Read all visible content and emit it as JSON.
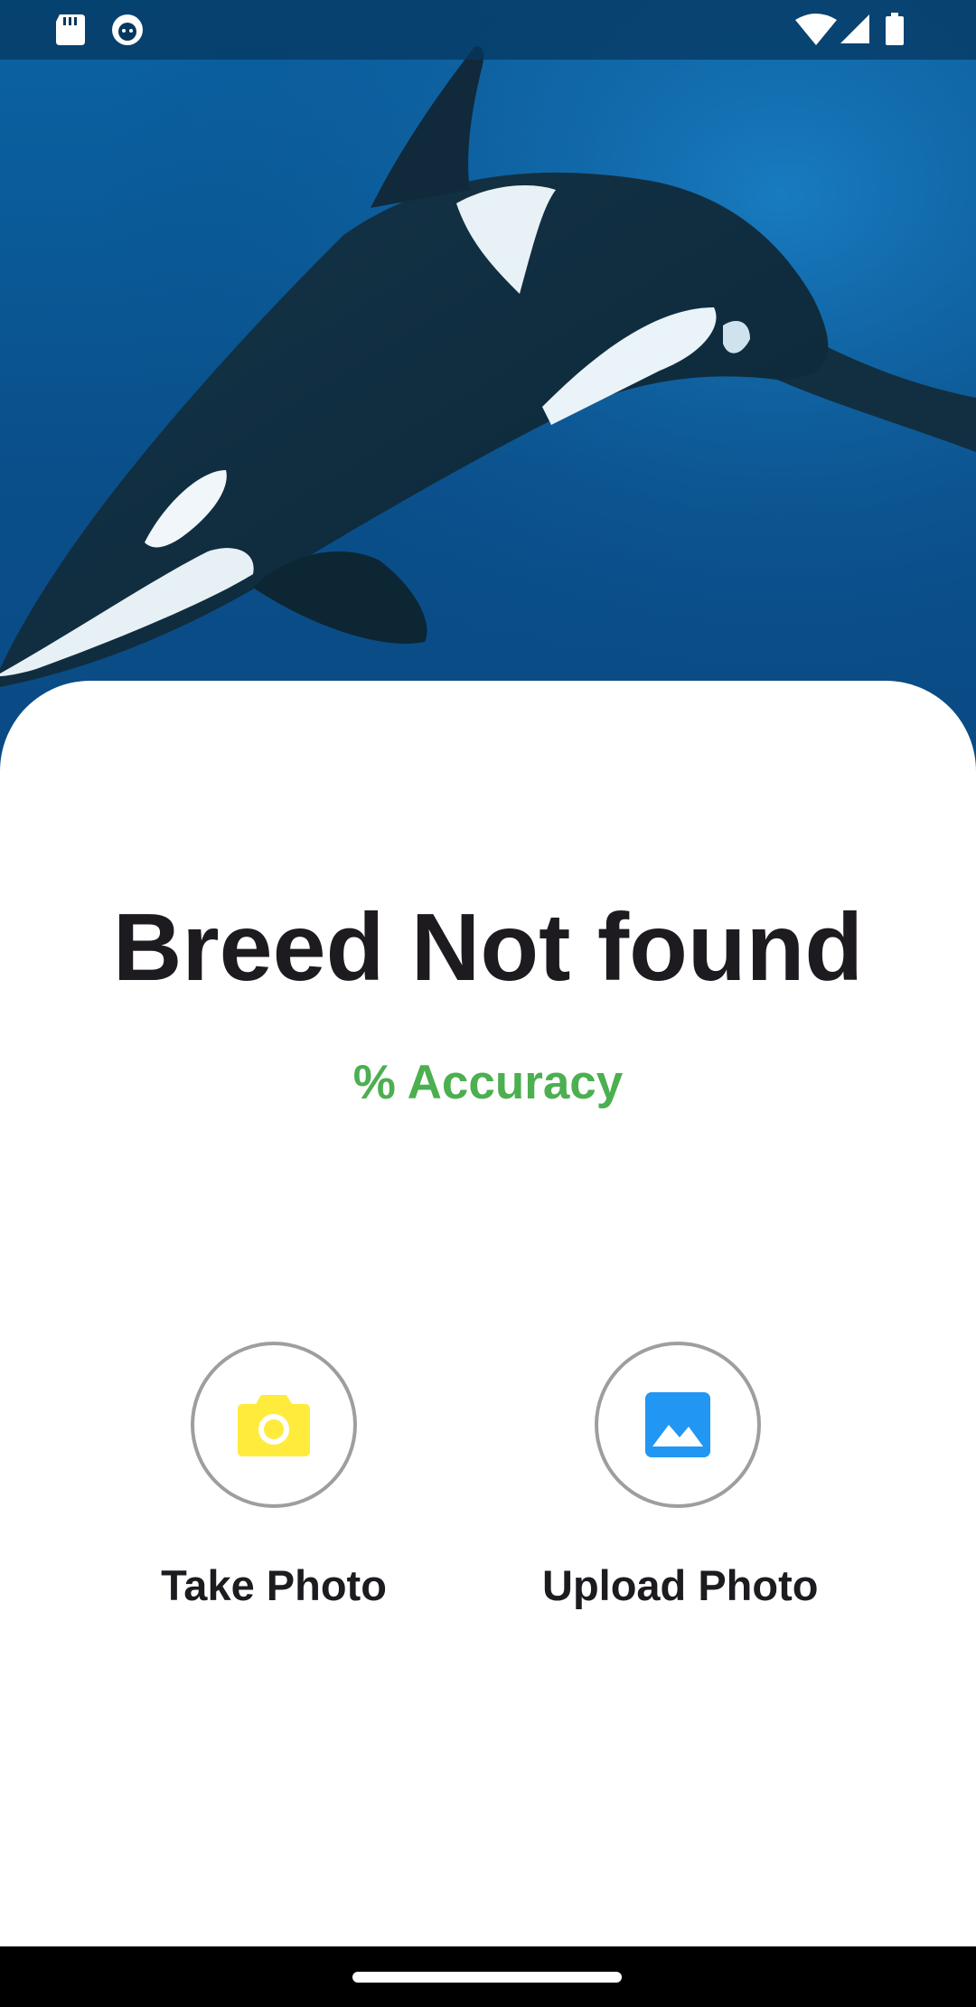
{
  "status_bar": {
    "left_icons": [
      "sd-card-icon",
      "app-notification-icon"
    ],
    "right_icons": [
      "wifi-icon",
      "signal-icon",
      "battery-icon"
    ]
  },
  "hero": {
    "image": "orca-whale-underwater-photo"
  },
  "result": {
    "title": "Breed Not found",
    "accuracy": "% Accuracy"
  },
  "actions": {
    "take_photo_label": "Take Photo",
    "upload_photo_label": "Upload Photo"
  },
  "colors": {
    "accuracy": "#4caf50",
    "camera_icon": "#ffeb3b",
    "gallery_icon": "#2196f3",
    "circle_border": "#9e9e9e",
    "title_text": "#1d1b20"
  }
}
